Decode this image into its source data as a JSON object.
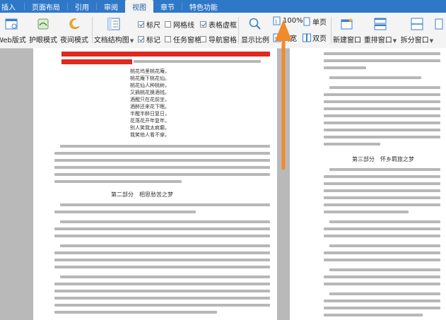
{
  "tabs": [
    "插入",
    "页面布局",
    "引用",
    "审阅",
    "视图",
    "章节",
    "特色功能"
  ],
  "active_tab_index": 4,
  "ribbon": {
    "web_layout": "Web版式",
    "eye_mode": "护眼模式",
    "night_mode": "夜间模式",
    "doc_structure": "文档结构图",
    "ruler": "标尺",
    "gridlines": "网格线",
    "table_virtual_frame": "表格虚框",
    "mark": "标记",
    "task_pane": "任务窗格",
    "nav_pane": "导航窗格",
    "show_ratio": "显示比例",
    "zoom_value": "100%",
    "page_width": "页宽",
    "single_page": "单页",
    "double_page": "双页",
    "new_window": "新建窗口",
    "rearrange_window": "重排窗口",
    "split_window": "拆分窗口"
  },
  "checkboxes": {
    "ruler": true,
    "gridlines": false,
    "table_virtual_frame": true,
    "mark": true,
    "task_pane": false,
    "nav_pane": false
  },
  "doc": {
    "left_poem": [
      "桃花坞里桃花庵，",
      "桃花庵下桃花仙。",
      "桃花仙人种桃树，",
      "又摘桃花换酒钱。",
      "酒醒只在花前坐，",
      "酒醉还来花下眠。",
      "半醒半醉日复日，",
      "花落花开年复年。",
      "别人笑我太疯癫，",
      "我笑他人看不穿。"
    ],
    "left_heading": "第二部分　相思愁苦之梦",
    "right_heading": "第三部分　怀乡羁旅之梦"
  },
  "colors": {
    "tab_bar": "#2f78c8",
    "highlight": "#e0281e",
    "arrow": "#f08a2a"
  }
}
